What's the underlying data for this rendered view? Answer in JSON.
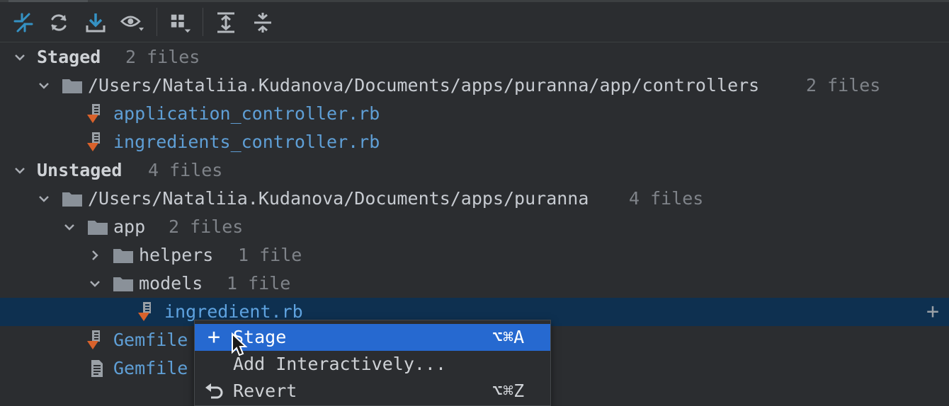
{
  "toolbar": {
    "buttons": [
      {
        "name": "commit-icon"
      },
      {
        "name": "refresh-icon"
      },
      {
        "name": "update-icon"
      },
      {
        "name": "eye-icon"
      },
      {
        "name": "group-by-icon"
      },
      {
        "name": "expand-all-icon"
      },
      {
        "name": "collapse-all-icon"
      }
    ]
  },
  "tree": {
    "staged": {
      "label": "Staged",
      "count": "2 files"
    },
    "staged_folder": {
      "path": "/Users/Nataliia.Kudanova/Documents/apps/puranna/app/controllers",
      "count": "2 files"
    },
    "staged_files": [
      "application_controller.rb",
      "ingredients_controller.rb"
    ],
    "unstaged": {
      "label": "Unstaged",
      "count": "4 files"
    },
    "unstaged_folder": {
      "path": "/Users/Nataliia.Kudanova/Documents/apps/puranna",
      "count": "4 files"
    },
    "app_folder": {
      "name": "app",
      "count": "2 files"
    },
    "helpers_folder": {
      "name": "helpers",
      "count": "1 file"
    },
    "models_folder": {
      "name": "models",
      "count": "1 file"
    },
    "selected_file": "ingredient.rb",
    "row_action": "+",
    "gemfile": "Gemfile",
    "gemfile2": "Gemfile"
  },
  "context_menu": {
    "items": [
      {
        "label": "Stage",
        "shortcut": "⌥⌘A",
        "icon": "plus-icon",
        "selected": true
      },
      {
        "label": "Add Interactively...",
        "shortcut": "",
        "icon": "",
        "selected": false
      },
      {
        "label": "Revert",
        "shortcut": "⌥⌘Z",
        "icon": "revert-icon",
        "selected": false
      }
    ],
    "plus_glyph": "+"
  },
  "colors": {
    "background": "#2b2d30",
    "selection": "#0e3050",
    "menu_selection": "#2669d0",
    "file_link": "#5f9fd6",
    "accent_icon": "#3592c4",
    "modified_marker": "#d9622b"
  }
}
